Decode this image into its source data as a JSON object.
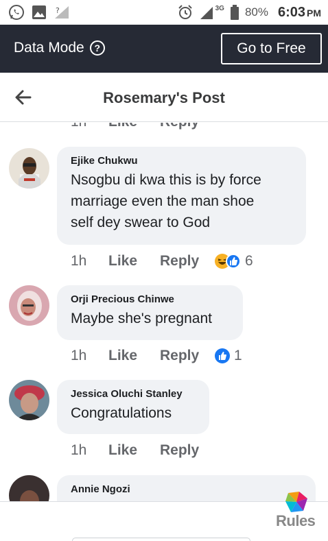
{
  "status_bar": {
    "battery": "80%",
    "time": "6:03",
    "ampm": "PM",
    "network": "3G"
  },
  "data_banner": {
    "label": "Data Mode",
    "button": "Go to Free"
  },
  "header": {
    "title": "Rosemary's Post"
  },
  "partial_row": {
    "time": "1h",
    "like": "Like",
    "reply": "Reply"
  },
  "comments": [
    {
      "name": "Ejike Chukwu",
      "lines": [
        "Nsogbu di kwa  this is by force",
        "marriage  even the man shoe",
        "self dey swear to God"
      ],
      "time": "1h",
      "like": "Like",
      "reply": "Reply",
      "reaction_count": "6",
      "reactions": [
        "haha-icon",
        "like-icon"
      ]
    },
    {
      "name": "Orji Precious Chinwe",
      "lines": [
        "Maybe she's pregnant"
      ],
      "time": "1h",
      "like": "Like",
      "reply": "Reply",
      "reaction_count": "1",
      "reactions": [
        "like-icon"
      ]
    },
    {
      "name": "Jessica Oluchi Stanley",
      "lines": [
        "Congratulations"
      ],
      "time": "1h",
      "like": "Like",
      "reply": "Reply"
    },
    {
      "name": "Annie Ngozi"
    }
  ],
  "watermark": {
    "text": "Rules"
  },
  "colors": {
    "banner_bg": "#262a35",
    "bubble_bg": "#f0f2f5",
    "like_blue": "#1877f2",
    "haha_yellow": "#f7b125"
  }
}
